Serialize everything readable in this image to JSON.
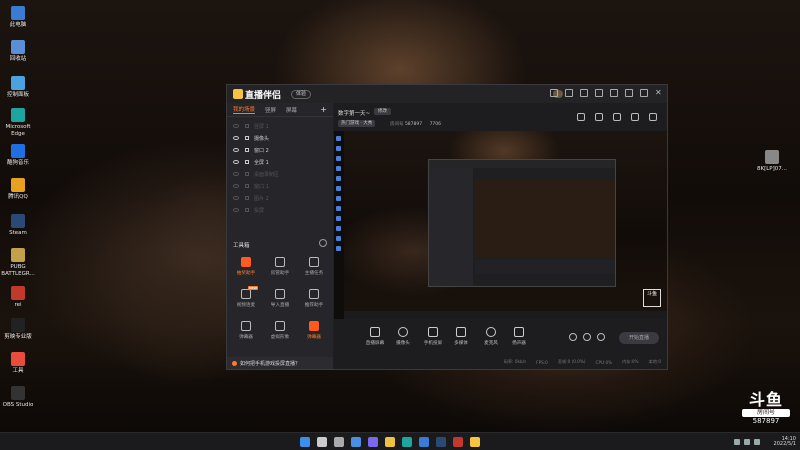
{
  "desktop": {
    "icons": [
      {
        "label": "此电脑",
        "color": "#3a7bd5"
      },
      {
        "label": "回收站",
        "color": "#5a8fd8"
      },
      {
        "label": "控制面板",
        "color": "#4aa3df"
      },
      {
        "label": "Microsoft Edge",
        "color": "#1fa5a0"
      },
      {
        "label": "酷狗音乐",
        "color": "#1f6fe0"
      },
      {
        "label": "腾讯QQ",
        "color": "#e8a21f"
      },
      {
        "label": "Steam",
        "color": "#2a4a75"
      },
      {
        "label": "PUBG BATTLEGR...",
        "color": "#c2a24a"
      },
      {
        "label": "rei",
        "color": "#c0392b"
      },
      {
        "label": "剪映专业版",
        "color": "#222222"
      },
      {
        "label": "工具",
        "color": "#e74c3c"
      },
      {
        "label": "OBS Studio",
        "color": "#333333"
      }
    ],
    "right_icon_label": "8K[LP]07...",
    "watermark": {
      "logo": "斗鱼",
      "room_label": "房间号",
      "room_number": "587897"
    }
  },
  "taskbar": {
    "time": "14:10",
    "date": "2022/5/1",
    "apps": [
      {
        "name": "windows-start-icon",
        "color": "#3b8eea"
      },
      {
        "name": "search-icon",
        "color": "#cccccc"
      },
      {
        "name": "task-view-icon",
        "color": "#aaaaaa"
      },
      {
        "name": "widgets-icon",
        "color": "#4a90e2"
      },
      {
        "name": "chat-icon",
        "color": "#7b68ee"
      },
      {
        "name": "file-explorer-icon",
        "color": "#f0c040"
      },
      {
        "name": "edge-icon",
        "color": "#1fa5a0"
      },
      {
        "name": "store-icon",
        "color": "#3a7bd5"
      },
      {
        "name": "steam-icon",
        "color": "#2a4a75"
      },
      {
        "name": "app-icon",
        "color": "#c0392b"
      },
      {
        "name": "douyu-companion-icon",
        "color": "#f5c542"
      }
    ]
  },
  "app": {
    "brand": "直播伴侣",
    "version_label": "体验",
    "scene_tabs": [
      "我的场景",
      "竖屏",
      "屏幕"
    ],
    "add_label": "+",
    "sources": [
      {
        "label": "竖屏 1",
        "on": false
      },
      {
        "label": "摄像头",
        "on": true
      },
      {
        "label": "窗口 2",
        "on": true
      },
      {
        "label": "全屏 1",
        "on": true
      },
      {
        "label": "桌面录制区",
        "on": false
      },
      {
        "label": "窗口 1",
        "on": false
      },
      {
        "label": "图片 2",
        "on": false
      },
      {
        "label": "投屏",
        "on": false
      }
    ],
    "tools_title": "工具箱",
    "tools": [
      {
        "label": "抽奖助手",
        "hot": true,
        "badge": ""
      },
      {
        "label": "房管助手",
        "hot": false,
        "badge": ""
      },
      {
        "label": "主播任务",
        "hot": false,
        "badge": ""
      },
      {
        "label": "视频连麦",
        "hot": false,
        "badge": "NEW"
      },
      {
        "label": "导入直播",
        "hot": false,
        "badge": ""
      },
      {
        "label": "推荐助手",
        "hot": false,
        "badge": ""
      },
      {
        "label": "弹幕器",
        "hot": false,
        "badge": ""
      },
      {
        "label": "虚拟形象",
        "hot": false,
        "badge": ""
      },
      {
        "label": "弹幕器",
        "hot": true,
        "badge": ""
      }
    ],
    "tip": "如何把手机游戏投屏直播？",
    "room_title": "数字第一天~",
    "edit_label": "修改",
    "category": "热门游戏 · 大秀",
    "room_id_label": "房间号",
    "room_id": "587897",
    "fans": "7706",
    "controls": [
      {
        "label": "直播屏幕",
        "shape": "square"
      },
      {
        "label": "摄像头",
        "shape": "round"
      },
      {
        "label": "手机投屏",
        "shape": "square"
      },
      {
        "label": "多媒体",
        "shape": "square"
      },
      {
        "label": "麦克风",
        "shape": "round"
      },
      {
        "label": "扬声器",
        "shape": "square"
      }
    ],
    "start_button": "开始直播",
    "status": [
      "码率: 0kb/s",
      "FPS:0",
      "丢帧:0 (0.0%)",
      "CPU:0%",
      "内存:0%",
      "本地:0"
    ]
  }
}
